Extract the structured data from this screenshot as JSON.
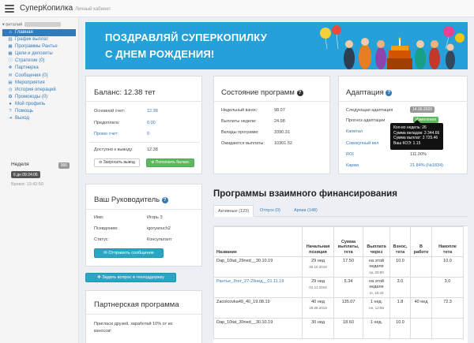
{
  "header": {
    "brand": "СуперКопилка",
    "subtitle": "Личный кабинет"
  },
  "sidebar": {
    "user_label": "виталий",
    "items": [
      {
        "icon": "home-icon",
        "glyph": "⌂",
        "label": "Главная"
      },
      {
        "icon": "chart-icon",
        "glyph": "▥",
        "label": "График выплат"
      },
      {
        "icon": "grid-icon",
        "glyph": "▦",
        "label": "Программы Рантье"
      },
      {
        "icon": "grid-icon",
        "glyph": "▦",
        "label": "Цели и депозиты"
      },
      {
        "icon": "info-icon",
        "glyph": "ⓘ",
        "label": "Стратегии (0)"
      },
      {
        "icon": "handshake-icon",
        "glyph": "✜",
        "label": "Партнерка"
      },
      {
        "icon": "envelope-icon",
        "glyph": "✉",
        "label": "Сообщения (0)"
      },
      {
        "icon": "calendar-icon",
        "glyph": "▤",
        "label": "Мероприятия"
      },
      {
        "icon": "history-icon",
        "glyph": "◷",
        "label": "История операций"
      },
      {
        "icon": "promo-icon",
        "glyph": "✪",
        "label": "Промокоды (0)"
      },
      {
        "icon": "user-icon",
        "glyph": "●",
        "label": "Мой профиль"
      },
      {
        "icon": "help-icon",
        "glyph": "?",
        "label": "Помощь"
      },
      {
        "icon": "exit-icon",
        "glyph": "⇥",
        "label": "Выход"
      }
    ],
    "week_label": "Неделя",
    "week_number": "366",
    "date_badge": "6 дн 09:24:06",
    "time_label": "Время: 13:42:50"
  },
  "banner": {
    "line1": "ПОЗДРАВЛЯЙ СУПЕРКОПИЛКУ",
    "line2": "С ДНЕМ РОЖДЕНИЯ!"
  },
  "balance": {
    "title": "Баланс: 12.38 тет",
    "rows": [
      {
        "label": "Основной счет:",
        "value": "12.38",
        "label_link": false,
        "value_link": true
      },
      {
        "label": "Предоплата:",
        "value": "0.00",
        "label_link": false,
        "value_link": true
      },
      {
        "label": "Промо счет:",
        "value": "0",
        "label_link": true,
        "value_link": true
      }
    ],
    "available_label": "Доступно к выводу:",
    "available_value": "12.38",
    "withdraw_btn": "Запросить вывод",
    "topup_btn": "Пополнить баланс"
  },
  "state": {
    "title": "Состояние программ",
    "rows": [
      {
        "label": "Недельный взнос:",
        "value": "98.07"
      },
      {
        "label": "Выплаты недели:",
        "value": "24.98"
      },
      {
        "label": "Вклады программ:",
        "value": "3390.31"
      },
      {
        "label": "Ожидаются выплаты:",
        "value": "10301.52"
      }
    ]
  },
  "adaptation": {
    "title": "Адаптация",
    "next_label": "Следующая адаптация",
    "next_value": "14.06.2020",
    "forecast_label": "Прогноз адаптации",
    "forecast_value": "Изменения",
    "capital_label": "Капитал",
    "cumulative_label": "Совокупный вкл",
    "roi_label": "ROI",
    "roi_value": "111.00%",
    "karma_label": "Карма",
    "karma_value": "21.84% (№1834)",
    "tooltip": [
      "Кол-во недель: 26",
      "Сумма вкладов: 3 344.66",
      "Сумма выплат: 3 725.46",
      "Ваш КОЭ: 1.15"
    ]
  },
  "leader": {
    "title": "Ваш Руководитель",
    "rows": [
      {
        "label": "Имя:",
        "value": "Игорь З"
      },
      {
        "label": "Псевдоним:",
        "value": "igoryanuch2"
      },
      {
        "label": "Статус:",
        "value": "Консультант"
      }
    ],
    "message_btn": "Отправить сообщение"
  },
  "support_btn": "Задать вопрос в техподдержку",
  "partner": {
    "title": "Партнерская программа",
    "text_line1": "Пригласи друзей, заработай 10% от их",
    "text_line2": "взносов!"
  },
  "programs": {
    "title": "Программы взаимного финансирования",
    "tabs": [
      "Активные (123)",
      "Отпуск (0)",
      "Архив (148)"
    ],
    "headers": [
      "Название",
      "Начальная позиция",
      "Сумма выплаты, тета",
      "Выплата через",
      "Взнос, тета",
      "В работе",
      "Накопле тета"
    ],
    "rows": [
      {
        "name": "Dap_10tat_29ned__30.10.19",
        "pos": "29 нед",
        "pos_date": "30.10.2019",
        "sum": "17.50",
        "via": "на этой неделе",
        "via_date": "ср, 20:00",
        "fee": "10.0",
        "work": "",
        "acc": "10.0",
        "link": false
      },
      {
        "name": "Рантье_3тет_27-29нед__01.11.19",
        "pos": "29 нед",
        "pos_date": "01.11.2019",
        "sum": "5.34",
        "via": "на этой неделе",
        "via_date": "пт, 15:42",
        "fee": "3.0",
        "work": "",
        "acc": "3.0",
        "link": true
      },
      {
        "name": "Zacolcovka49_40_19.08.19",
        "pos": "40 нед",
        "pos_date": "19.08.2019",
        "sum": "135.07",
        "via": "1 нед.",
        "via_date": "пн, 12:58",
        "fee": "1.8",
        "work": "40 нед",
        "acc": "72.3",
        "link": false
      },
      {
        "name": "Dap_10tat_30ned__30.10.19",
        "pos": "30 нед",
        "pos_date": "",
        "sum": "18.60",
        "via": "1 нед.",
        "via_date": "",
        "fee": "10.0",
        "work": "",
        "acc": "",
        "link": false
      }
    ]
  },
  "colors": {
    "primary": "#337ab7",
    "success": "#5cb85c",
    "info": "#2aa6c5",
    "banner": "#26a0d8"
  }
}
